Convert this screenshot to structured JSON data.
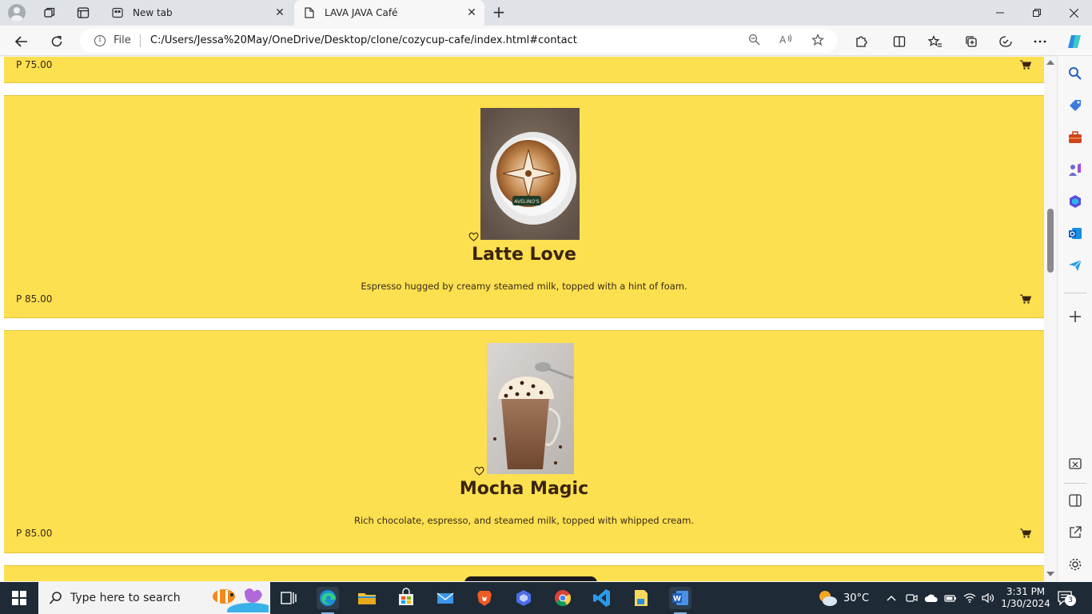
{
  "browser": {
    "tabs": [
      {
        "label": "New tab",
        "active": false
      },
      {
        "label": "LAVA JAVA Café",
        "active": true
      }
    ],
    "address": {
      "scheme_label": "File",
      "url": "C:/Users/Jessa%20May/OneDrive/Desktop/clone/cozycup-cafe/index.html#contact"
    }
  },
  "page": {
    "top_card": {
      "price": "P 75.00"
    },
    "products": [
      {
        "title": "Latte Love",
        "description": "Espresso hugged by creamy steamed milk, topped with a hint of foam.",
        "price": "P 85.00"
      },
      {
        "title": "Mocha Magic",
        "description": "Rich chocolate, espresso, and steamed milk, topped with whipped cream.",
        "price": "P 85.00"
      }
    ]
  },
  "taskbar": {
    "search_placeholder": "Type here to search",
    "weather": "30°C",
    "time": "3:31 PM",
    "date": "1/30/2024",
    "notifications": "3"
  },
  "colors": {
    "card_bg": "#fce04f",
    "title_text": "#3b2410",
    "taskbar_bg": "#1e2a36"
  }
}
